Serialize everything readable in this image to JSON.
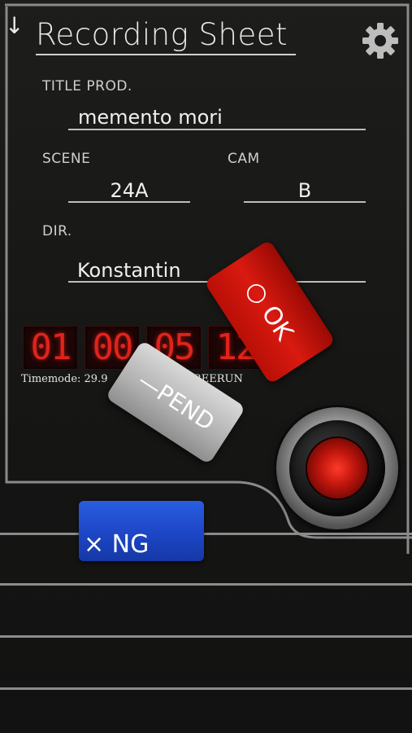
{
  "header": {
    "back_arrow": "↓",
    "title": "Recording Sheet",
    "settings_icon": "gear-icon"
  },
  "fields": {
    "title_prod": {
      "label": "TITLE PROD.",
      "value": "memento mori"
    },
    "scene": {
      "label": "SCENE",
      "value": "24A"
    },
    "cam": {
      "label": "CAM",
      "value": "B"
    },
    "dir": {
      "label": "DIR.",
      "value": "Konstantin"
    }
  },
  "timecode": {
    "hours": "01",
    "minutes": "00",
    "seconds": "05",
    "frames": "12",
    "timemode_text": "Timemode: 29.9",
    "timemode_suffix": "REERUN"
  },
  "status_buttons": {
    "ok_label": "○ OK",
    "pend_label": "—PEND",
    "ng_label": "× NG"
  },
  "colors": {
    "background": "#151515",
    "timecode_red": "#e0231b",
    "ok_red": "#c8140b",
    "ng_blue": "#1d46c6",
    "pend_gray": "#b0b0b0"
  }
}
